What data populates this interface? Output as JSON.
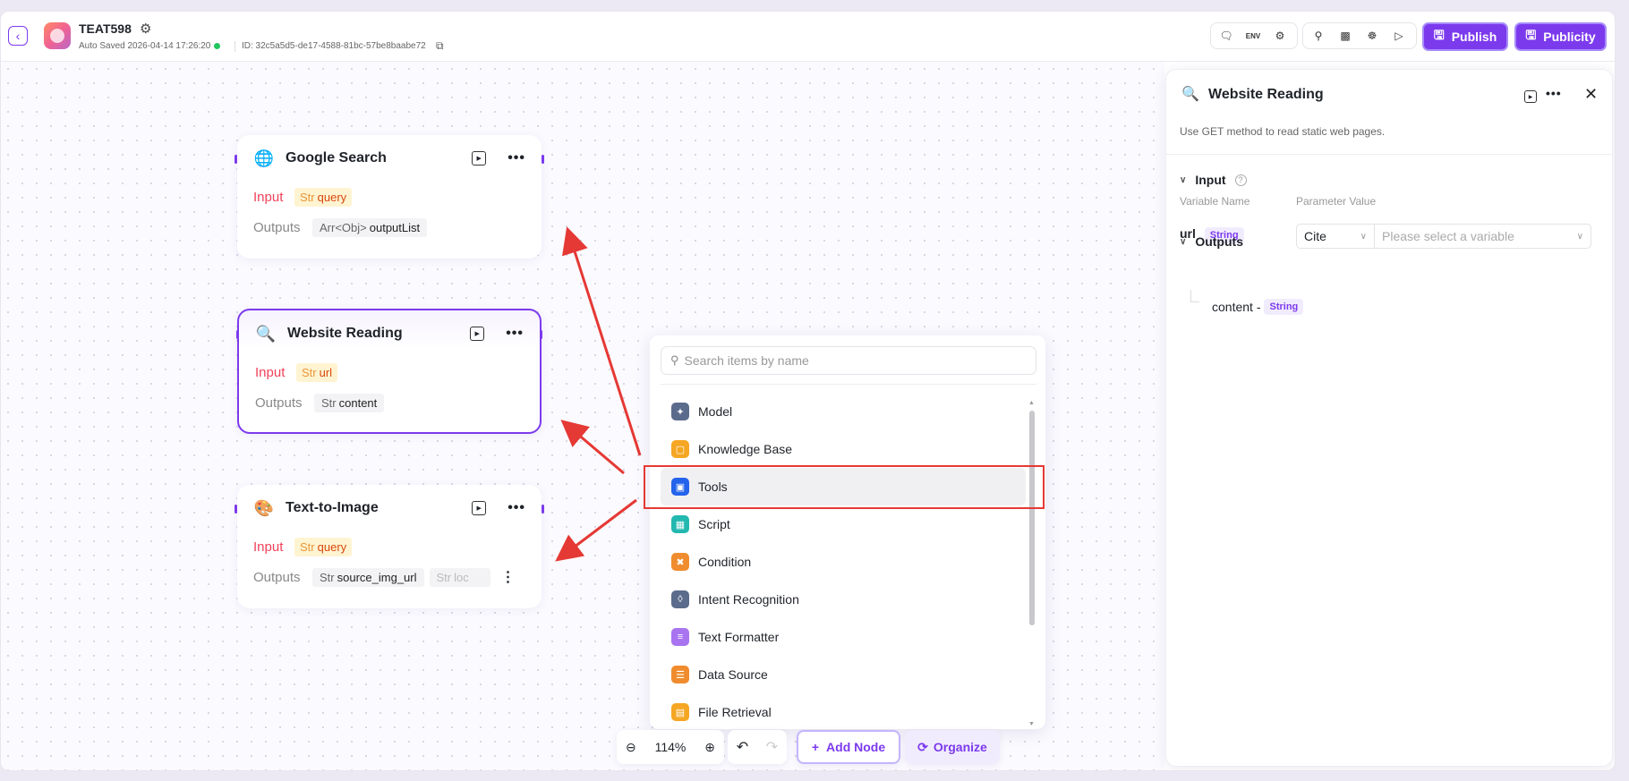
{
  "header": {
    "app_title": "TEAT598",
    "auto_saved": "Auto Saved  2026-04-14 17:26:20",
    "app_id": "ID: 32c5a5d5-de17-4588-81bc-57be8baabe72",
    "env_label": "ENV",
    "publish_label": "Publish",
    "publicity_label": "Publicity"
  },
  "nodes": [
    {
      "title": "Google Search",
      "icon": "globe-search-icon",
      "input_label": "Input",
      "input_type": "Str",
      "input_name": "query",
      "output_label": "Outputs",
      "outputs": [
        {
          "type": "Arr<Obj>",
          "name": "outputList"
        }
      ]
    },
    {
      "title": "Website Reading",
      "icon": "magnifier-icon",
      "input_label": "Input",
      "input_type": "Str",
      "input_name": "url",
      "output_label": "Outputs",
      "outputs": [
        {
          "type": "Str",
          "name": "content"
        }
      ]
    },
    {
      "title": "Text-to-Image",
      "icon": "paint-palette-icon",
      "input_label": "Input",
      "input_type": "Str",
      "input_name": "query",
      "output_label": "Outputs",
      "outputs": [
        {
          "type": "Str",
          "name": "source_img_url"
        },
        {
          "type": "Str",
          "name": "loc"
        }
      ]
    }
  ],
  "menu": {
    "search_placeholder": "Search items by name",
    "items": [
      {
        "label": "Model",
        "icon": "model-icon",
        "color": "#5b6b8c"
      },
      {
        "label": "Knowledge Base",
        "icon": "book-icon",
        "color": "#f5a623"
      },
      {
        "label": "Tools",
        "icon": "toolbox-icon",
        "color": "#2463eb"
      },
      {
        "label": "Script",
        "icon": "script-icon",
        "color": "#22b8b0"
      },
      {
        "label": "Condition",
        "icon": "branch-icon",
        "color": "#f08c2e"
      },
      {
        "label": "Intent Recognition",
        "icon": "intent-icon",
        "color": "#5b6b8c"
      },
      {
        "label": "Text Formatter",
        "icon": "text-icon",
        "color": "#a874f0"
      },
      {
        "label": "Data Source",
        "icon": "database-icon",
        "color": "#f08c2e"
      },
      {
        "label": "File Retrieval",
        "icon": "file-icon",
        "color": "#f5a623"
      }
    ]
  },
  "bottom": {
    "zoom": "114%",
    "add_node": "Add Node",
    "organize": "Organize"
  },
  "panel": {
    "title": "Website Reading",
    "description": "Use GET method to read static web pages.",
    "input_section": "Input",
    "col_variable": "Variable Name",
    "col_parameter": "Parameter Value",
    "var_name": "url",
    "var_type": "String",
    "cite_value": "Cite",
    "var_placeholder": "Please select a variable",
    "outputs_section": "Outputs",
    "output_name": "content -",
    "output_type": "String"
  },
  "colors": {
    "accent": "#7c3aed",
    "annotation_red": "#e53935",
    "input_red": "#f0425b"
  }
}
